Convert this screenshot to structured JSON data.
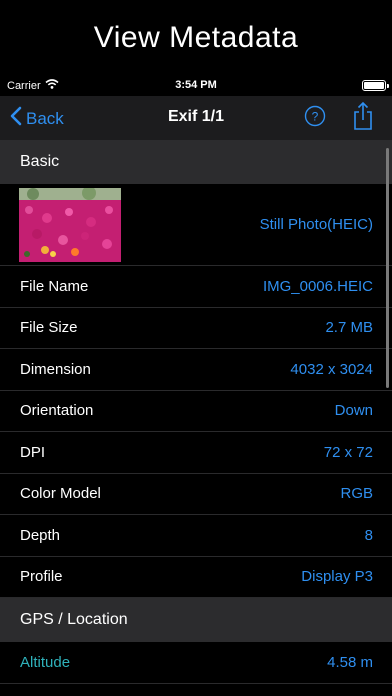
{
  "promo": {
    "title": "View Metadata"
  },
  "status_bar": {
    "carrier": "Carrier",
    "time": "3:54 PM"
  },
  "nav": {
    "back_label": "Back",
    "title": "Exif 1/1",
    "help_glyph": "?"
  },
  "sections": {
    "basic": {
      "title": "Basic",
      "thumbnail_value": "Still Photo(HEIC)",
      "rows": [
        {
          "label": "File Name",
          "value": "IMG_0006.HEIC"
        },
        {
          "label": "File Size",
          "value": "2.7 MB"
        },
        {
          "label": "Dimension",
          "value": "4032 x 3024"
        },
        {
          "label": "Orientation",
          "value": "Down"
        },
        {
          "label": "DPI",
          "value": "72 x 72"
        },
        {
          "label": "Color Model",
          "value": "RGB"
        },
        {
          "label": "Depth",
          "value": "8"
        },
        {
          "label": "Profile",
          "value": "Display P3"
        }
      ]
    },
    "gps": {
      "title": "GPS / Location",
      "rows": [
        {
          "label": "Altitude",
          "value": "4.58 m"
        }
      ]
    }
  },
  "colors": {
    "accent_blue": "#2f8ff0",
    "teal_label": "#2fb2bb",
    "section_bg": "#2c2c2e",
    "nav_bg": "#1c1c1e"
  },
  "icons": [
    "wifi-icon",
    "battery-icon",
    "chevron-left-icon",
    "help-icon",
    "share-icon"
  ]
}
